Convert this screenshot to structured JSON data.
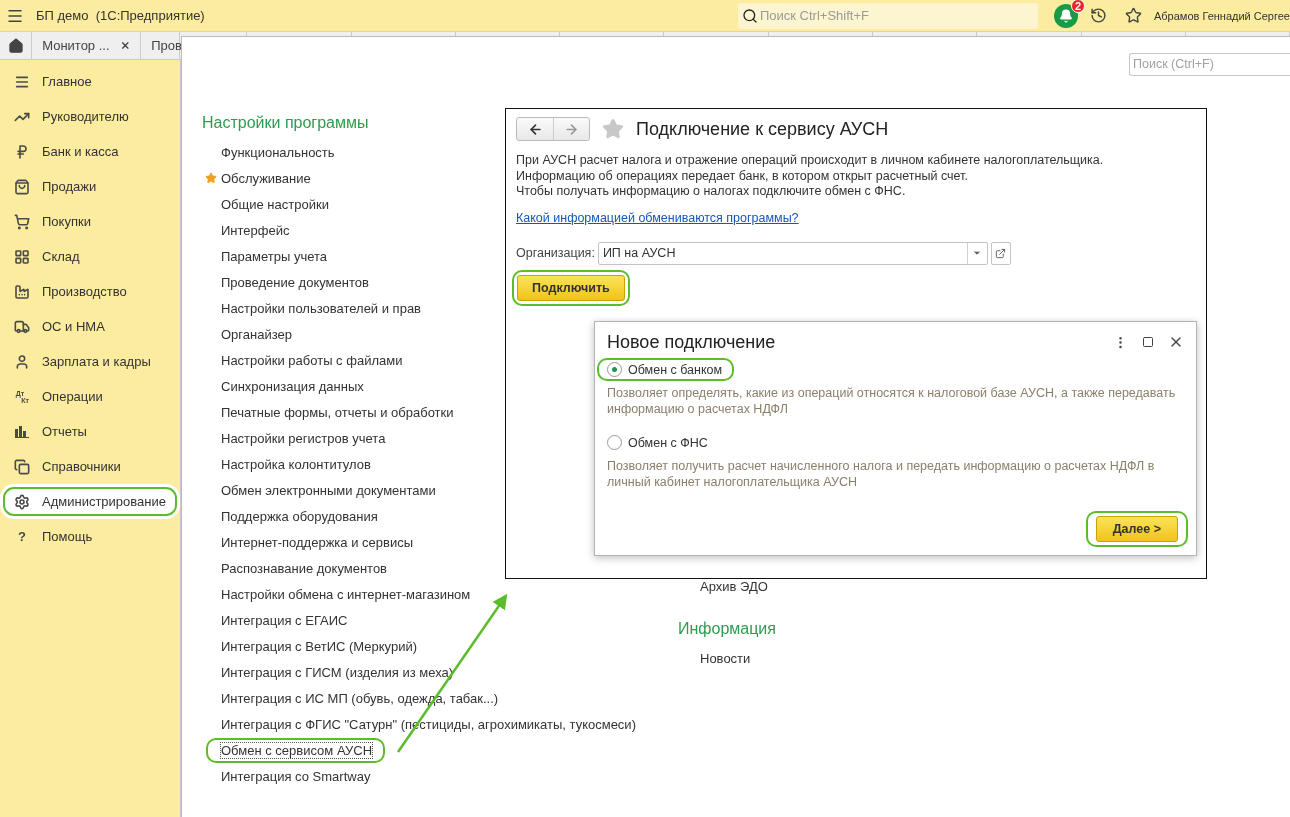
{
  "app": {
    "title": "БП демо  (1С:Предприятие)",
    "search_placeholder": "Поиск Ctrl+Shift+F",
    "notification_count": "2",
    "user": "Абрамов Геннадий Сергее"
  },
  "tabs": [
    {
      "label": "Монитор ...",
      "closable": true
    },
    {
      "label": "Пров"
    }
  ],
  "sidebar": {
    "items": [
      {
        "label": "Главное",
        "selected": false,
        "highlighted": false
      },
      {
        "label": "Руководителю",
        "selected": false,
        "highlighted": false
      },
      {
        "label": "Банк и касса",
        "selected": false,
        "highlighted": false
      },
      {
        "label": "Продажи",
        "selected": false,
        "highlighted": false
      },
      {
        "label": "Покупки",
        "selected": false,
        "highlighted": false
      },
      {
        "label": "Склад",
        "selected": false,
        "highlighted": false
      },
      {
        "label": "Производство",
        "selected": false,
        "highlighted": false
      },
      {
        "label": "ОС и НМА",
        "selected": false,
        "highlighted": false
      },
      {
        "label": "Зарплата и кадры",
        "selected": false,
        "highlighted": false
      },
      {
        "label": "Операции",
        "selected": false,
        "highlighted": false,
        "icon_label": [
          "Дт",
          "Кт"
        ]
      },
      {
        "label": "Отчеты",
        "selected": false,
        "highlighted": false
      },
      {
        "label": "Справочники",
        "selected": false,
        "highlighted": false
      },
      {
        "label": "Администрирование",
        "selected": true,
        "highlighted": true
      },
      {
        "label": "Помощь",
        "selected": false,
        "highlighted": false,
        "icon_label": [
          "?"
        ]
      }
    ]
  },
  "content": {
    "search_placeholder": "Поиск (Ctrl+F)",
    "settings": {
      "title": "Настройки программы",
      "items": [
        {
          "label": "Функциональность",
          "favorite": false,
          "highlighted": false
        },
        {
          "label": "Обслуживание",
          "favorite": true,
          "highlighted": false
        },
        {
          "label": "Общие настройки",
          "favorite": false,
          "highlighted": false
        },
        {
          "label": "Интерфейс",
          "favorite": false,
          "highlighted": false
        },
        {
          "label": "Параметры учета",
          "favorite": false,
          "highlighted": false
        },
        {
          "label": "Проведение документов",
          "favorite": false,
          "highlighted": false
        },
        {
          "label": "Настройки пользователей и прав",
          "favorite": false,
          "highlighted": false
        },
        {
          "label": "Органайзер",
          "favorite": false,
          "highlighted": false
        },
        {
          "label": "Настройки работы с файлами",
          "favorite": false,
          "highlighted": false
        },
        {
          "label": "Синхронизация данных",
          "favorite": false,
          "highlighted": false
        },
        {
          "label": "Печатные формы, отчеты и обработки",
          "favorite": false,
          "highlighted": false
        },
        {
          "label": "Настройки регистров учета",
          "favorite": false,
          "highlighted": false
        },
        {
          "label": "Настройка колонтитулов",
          "favorite": false,
          "highlighted": false
        },
        {
          "label": "Обмен электронными документами",
          "favorite": false,
          "highlighted": false
        },
        {
          "label": "Поддержка оборудования",
          "favorite": false,
          "highlighted": false
        },
        {
          "label": "Интернет-поддержка и сервисы",
          "favorite": false,
          "highlighted": false
        },
        {
          "label": "Распознавание документов",
          "favorite": false,
          "highlighted": false
        },
        {
          "label": "Настройки обмена с интернет-магазином",
          "favorite": false,
          "highlighted": false
        },
        {
          "label": "Интеграция с ЕГАИС",
          "favorite": false,
          "highlighted": false
        },
        {
          "label": "Интеграция с ВетИС (Меркурий)",
          "favorite": false,
          "highlighted": false
        },
        {
          "label": "Интеграция с ГИСМ (изделия из меха)",
          "favorite": false,
          "highlighted": false
        },
        {
          "label": "Интеграция с ИС МП (обувь, одежда, табак...)",
          "favorite": false,
          "highlighted": false
        },
        {
          "label": "Интеграция с ФГИС \"Сатурн\" (пестициды, агрохимикаты, тукосмеси)",
          "favorite": false,
          "highlighted": false
        },
        {
          "label": "Обмен с сервисом АУСН",
          "favorite": false,
          "highlighted": true
        },
        {
          "label": "Интеграция со Smartway",
          "favorite": false,
          "highlighted": false
        }
      ]
    },
    "other_links": [
      {
        "label": "Архив ЭДО"
      }
    ],
    "information": {
      "title": "Информация",
      "items": [
        {
          "label": "Новости"
        }
      ]
    }
  },
  "connect_window": {
    "title": "Подключение к сервису АУСН",
    "description": [
      "При АУСН расчет налога и отражение операций происходит в личном кабинете налогоплательщика.",
      "Информацию об операциях передает банк, в котором открыт расчетный счет.",
      "Чтобы получать информацию о налогах подключите обмен с ФНС."
    ],
    "link": "Какой информацией обмениваются программы?",
    "organization": {
      "label": "Организация:",
      "value": "ИП на АУСН"
    },
    "button": {
      "label": "Подключить",
      "highlighted": true
    }
  },
  "new_connection_dialog": {
    "title": "Новое подключение",
    "options": [
      {
        "label": "Обмен с банком",
        "selected": true,
        "highlighted": true,
        "description": "Позволяет определять, какие из операций относятся к налоговой базе АУСН, а также передавать информацию о расчетах НДФЛ"
      },
      {
        "label": "Обмен с ФНС",
        "selected": false,
        "highlighted": false,
        "description": "Позволяет получить расчет начисленного налога и передать информацию о расчетах НДФЛ в личный кабинет налогоплательщика АУСН"
      }
    ],
    "button": {
      "label": "Далее >",
      "highlighted": true
    }
  }
}
